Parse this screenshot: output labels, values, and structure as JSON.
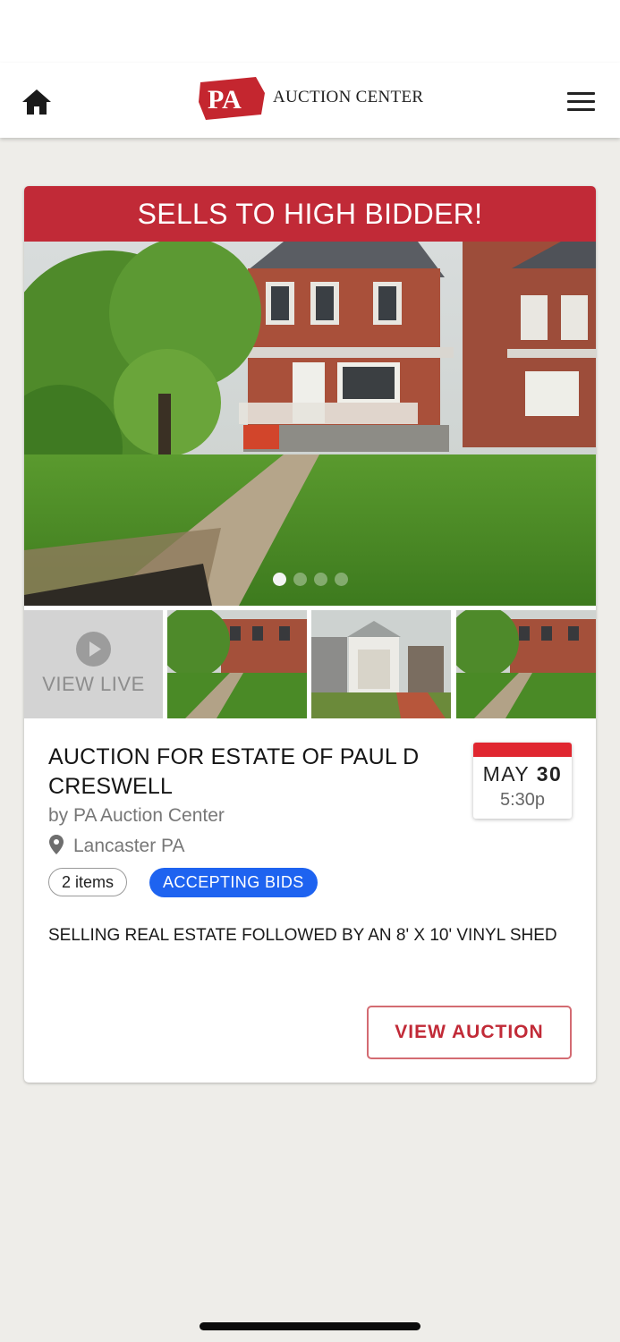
{
  "header": {
    "logo_badge": "PA",
    "logo_text": "AUCTION CENTER",
    "home_icon": "home-icon",
    "menu_icon": "hamburger-menu-icon"
  },
  "listing": {
    "banner": "SELLS TO HIGH BIDDER!",
    "carousel": {
      "slides": 4,
      "active_index": 0
    },
    "view_live_label": "VIEW LIVE",
    "title": "AUCTION FOR ESTATE OF PAUL D CRESWELL",
    "byline": "by PA Auction Center",
    "location": "Lancaster PA",
    "date": {
      "month": "MAY",
      "day": "30",
      "time": "5:30p"
    },
    "items_count_label": "2 items",
    "status_label": "ACCEPTING BIDS",
    "description": "SELLING REAL ESTATE FOLLOWED BY AN 8' X 10' VINYL SHED",
    "view_auction_label": "VIEW AUCTION"
  },
  "colors": {
    "brand_red": "#c12a37",
    "status_blue": "#1e63f0",
    "date_red": "#e0262f",
    "page_bg": "#eeede9"
  }
}
